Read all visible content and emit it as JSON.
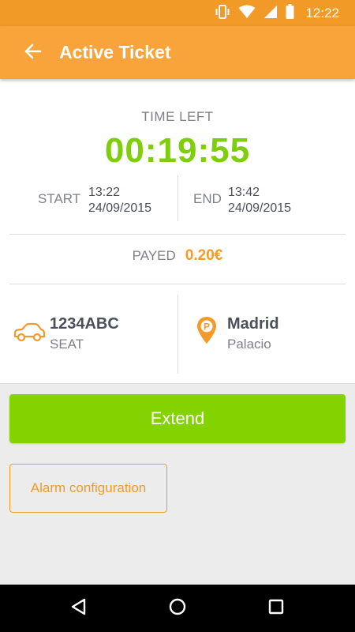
{
  "status_bar": {
    "time": "12:22",
    "icons": [
      "vibrate-icon",
      "wifi-icon",
      "cellular-signal-icon",
      "battery-icon"
    ]
  },
  "app_bar": {
    "title": "Active Ticket",
    "back_icon": "arrow-left-icon"
  },
  "ticket": {
    "time_left_label": "TIME LEFT",
    "time_left_value": "00:19:55",
    "start": {
      "label": "START",
      "time": "13:22",
      "date": "24/09/2015"
    },
    "end": {
      "label": "END",
      "time": "13:42",
      "date": "24/09/2015"
    },
    "payed": {
      "label": "PAYED",
      "amount": "0.20€"
    },
    "vehicle": {
      "plate": "1234ABC",
      "make": "SEAT",
      "icon": "car-icon"
    },
    "location": {
      "city": "Madrid",
      "zone": "Palacio",
      "icon": "parking-pin-icon"
    }
  },
  "actions": {
    "extend_label": "Extend",
    "alarm_label": "Alarm configuration"
  },
  "nav": {
    "icons": [
      "back-triangle-icon",
      "home-circle-icon",
      "recents-square-icon"
    ]
  },
  "colors": {
    "primary_orange": "#f8a43a",
    "status_orange": "#f29a28",
    "accent_green": "#84d200",
    "timer_green": "#7fce0a",
    "amount_orange": "#f49a2a"
  }
}
